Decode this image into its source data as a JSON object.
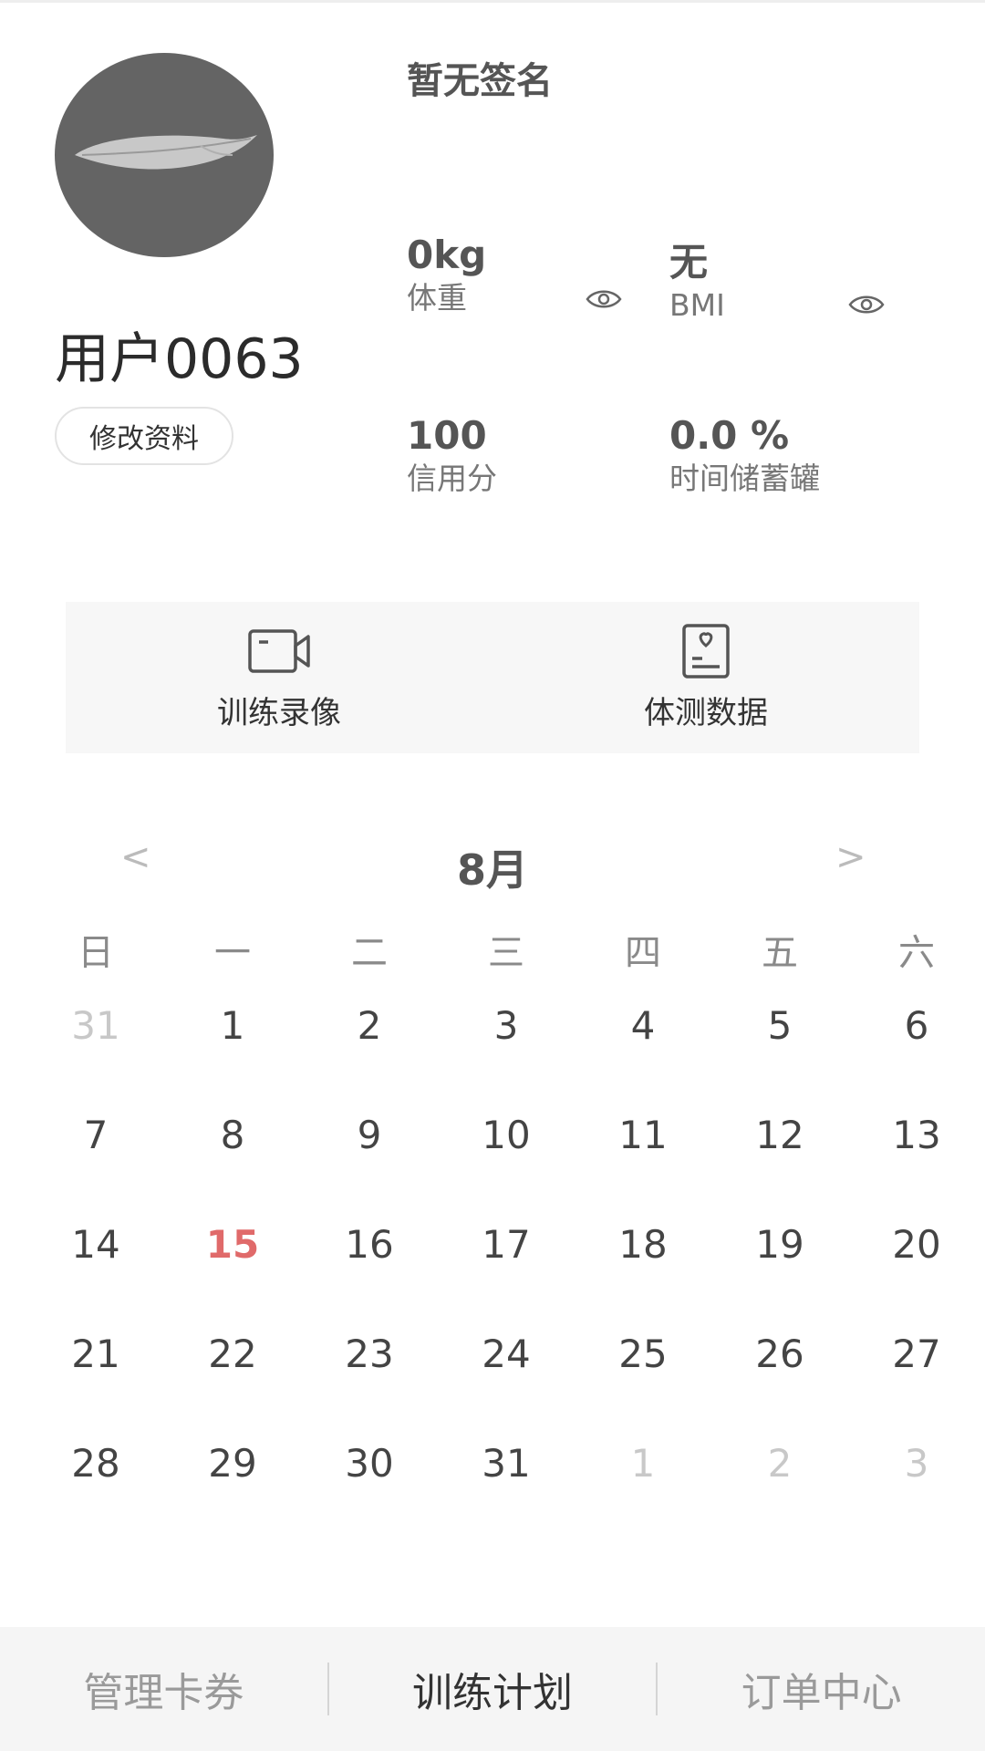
{
  "profile": {
    "username": "用户0063",
    "edit_button": "修改资料",
    "signature": "暂无签名",
    "avatar_icon": "feather-icon"
  },
  "stats": {
    "weight_value": "0kg",
    "weight_label": "体重",
    "bmi_value": "无",
    "bmi_label": "BMI",
    "credit_value": "100",
    "credit_label": "信用分",
    "jar_value": "0.0 %",
    "jar_label": "时间储蓄罐"
  },
  "actions": {
    "video_label": "训练录像",
    "body_data_label": "体测数据"
  },
  "calendar": {
    "month": "8月",
    "prev": "<",
    "next": ">",
    "weekdays": [
      "日",
      "一",
      "二",
      "三",
      "四",
      "五",
      "六"
    ],
    "weeks": [
      [
        "31",
        "1",
        "2",
        "3",
        "4",
        "5",
        "6"
      ],
      [
        "7",
        "8",
        "9",
        "10",
        "11",
        "12",
        "13"
      ],
      [
        "14",
        "15",
        "16",
        "17",
        "18",
        "19",
        "20"
      ],
      [
        "21",
        "22",
        "23",
        "24",
        "25",
        "26",
        "27"
      ],
      [
        "28",
        "29",
        "30",
        "31",
        "1",
        "2",
        "3"
      ]
    ],
    "today": "15",
    "accent_color": "#e06a6a"
  },
  "tabs": {
    "cards": "管理卡券",
    "plan": "训练计划",
    "orders": "订单中心"
  }
}
